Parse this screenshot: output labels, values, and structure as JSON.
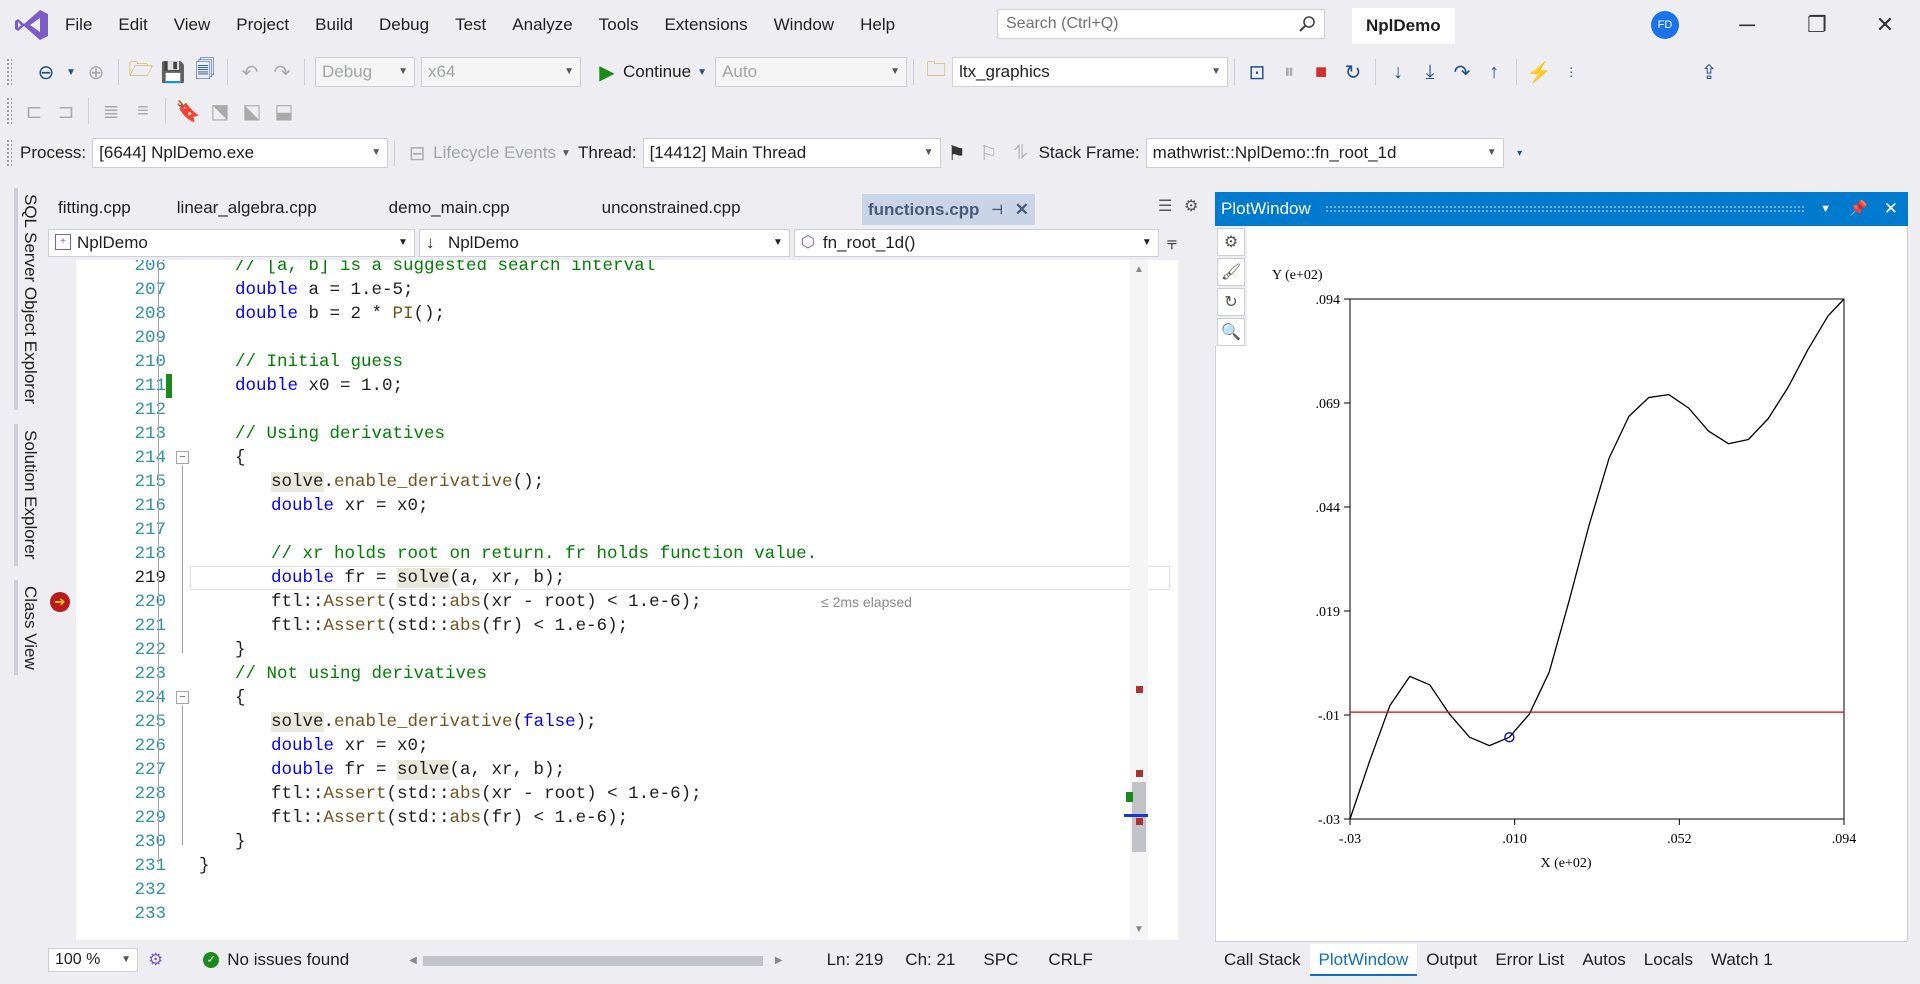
{
  "menu": [
    "File",
    "Edit",
    "View",
    "Project",
    "Build",
    "Debug",
    "Test",
    "Analyze",
    "Tools",
    "Extensions",
    "Window",
    "Help"
  ],
  "search": {
    "placeholder": "Search (Ctrl+Q)"
  },
  "solution_name": "NplDemo",
  "user_initials": "FD",
  "toolbar1": {
    "config": "Debug",
    "platform": "x64",
    "continue_label": "Continue",
    "auto_label": "Auto",
    "project": "ltx_graphics"
  },
  "toolbar3": {
    "process_label": "Process:",
    "process_value": "[6644] NplDemo.exe",
    "lifecycle_label": "Lifecycle Events",
    "thread_label": "Thread:",
    "thread_value": "[14412] Main Thread",
    "stack_label": "Stack Frame:",
    "stack_value": "mathwrist::NplDemo::fn_root_1d"
  },
  "side_tabs": [
    "SQL Server Object Explorer",
    "Solution Explorer",
    "Class View"
  ],
  "doc_tabs": [
    "fitting.cpp",
    "linear_algebra.cpp",
    "demo_main.cpp",
    "unconstrained.cpp"
  ],
  "active_tab": "functions.cpp",
  "nav": {
    "project": "NplDemo",
    "scope": "NplDemo",
    "member": "fn_root_1d()"
  },
  "code": [
    {
      "ln": "206",
      "segs": [
        [
          "cm",
          "// [a, b] is a suggested search interval"
        ]
      ],
      "indent": 1
    },
    {
      "ln": "207",
      "segs": [
        [
          "kw",
          "double"
        ],
        [
          "",
          " a = 1.e-5;"
        ]
      ],
      "indent": 1
    },
    {
      "ln": "208",
      "segs": [
        [
          "kw",
          "double"
        ],
        [
          "",
          " b = 2 * "
        ],
        [
          "fn",
          "PI"
        ],
        [
          "",
          "();"
        ]
      ],
      "indent": 1
    },
    {
      "ln": "209",
      "segs": [],
      "indent": 1
    },
    {
      "ln": "210",
      "segs": [
        [
          "cm",
          "// Initial guess"
        ]
      ],
      "indent": 1
    },
    {
      "ln": "211",
      "segs": [
        [
          "kw",
          "double"
        ],
        [
          "",
          " x0 = 1.0;"
        ]
      ],
      "indent": 1
    },
    {
      "ln": "212",
      "segs": [],
      "indent": 1
    },
    {
      "ln": "213",
      "segs": [
        [
          "cm",
          "// Using derivatives"
        ]
      ],
      "indent": 1
    },
    {
      "ln": "214",
      "segs": [
        [
          "",
          "{"
        ]
      ],
      "indent": 1
    },
    {
      "ln": "215",
      "segs": [
        [
          "hl",
          "solve"
        ],
        [
          "",
          "."
        ],
        [
          "fn",
          "enable_derivative"
        ],
        [
          "",
          "();"
        ]
      ],
      "indent": 2
    },
    {
      "ln": "216",
      "segs": [
        [
          "kw",
          "double"
        ],
        [
          "",
          " xr = x0;"
        ]
      ],
      "indent": 2
    },
    {
      "ln": "217",
      "segs": [],
      "indent": 2
    },
    {
      "ln": "218",
      "segs": [
        [
          "cm",
          "// xr holds root on return. fr holds function value."
        ]
      ],
      "indent": 2
    },
    {
      "ln": "219",
      "segs": [
        [
          "kw",
          "double"
        ],
        [
          "",
          " fr = "
        ],
        [
          "hl",
          "solve"
        ],
        [
          "",
          "(a, xr, b);"
        ]
      ],
      "indent": 2
    },
    {
      "ln": "220",
      "segs": [
        [
          "",
          "ftl::"
        ],
        [
          "fn",
          "Assert"
        ],
        [
          "",
          "(std::"
        ],
        [
          "fn",
          "abs"
        ],
        [
          "",
          "(xr - root) < 1.e-6);"
        ]
      ],
      "indent": 2
    },
    {
      "ln": "221",
      "segs": [
        [
          "",
          "ftl::"
        ],
        [
          "fn",
          "Assert"
        ],
        [
          "",
          "(std::"
        ],
        [
          "fn",
          "abs"
        ],
        [
          "",
          "(fr) < 1.e-6);"
        ]
      ],
      "indent": 2
    },
    {
      "ln": "222",
      "segs": [
        [
          "",
          "}"
        ]
      ],
      "indent": 1
    },
    {
      "ln": "223",
      "segs": [
        [
          "cm",
          "// Not using derivatives"
        ]
      ],
      "indent": 1
    },
    {
      "ln": "224",
      "segs": [
        [
          "",
          "{"
        ]
      ],
      "indent": 1
    },
    {
      "ln": "225",
      "segs": [
        [
          "hl",
          "solve"
        ],
        [
          "",
          "."
        ],
        [
          "fn",
          "enable_derivative"
        ],
        [
          "",
          "("
        ],
        [
          "kw",
          "false"
        ],
        [
          "",
          ");"
        ]
      ],
      "indent": 2
    },
    {
      "ln": "226",
      "segs": [
        [
          "kw",
          "double"
        ],
        [
          "",
          " xr = x0;"
        ]
      ],
      "indent": 2
    },
    {
      "ln": "227",
      "segs": [
        [
          "kw",
          "double"
        ],
        [
          "",
          " fr = "
        ],
        [
          "hl",
          "solve"
        ],
        [
          "",
          "(a, xr, b);"
        ]
      ],
      "indent": 2
    },
    {
      "ln": "228",
      "segs": [
        [
          "",
          "ftl::"
        ],
        [
          "fn",
          "Assert"
        ],
        [
          "",
          "(std::"
        ],
        [
          "fn",
          "abs"
        ],
        [
          "",
          "(xr - root) < 1.e-6);"
        ]
      ],
      "indent": 2
    },
    {
      "ln": "229",
      "segs": [
        [
          "",
          "ftl::"
        ],
        [
          "fn",
          "Assert"
        ],
        [
          "",
          "(std::"
        ],
        [
          "fn",
          "abs"
        ],
        [
          "",
          "(fr) < 1.e-6);"
        ]
      ],
      "indent": 2
    },
    {
      "ln": "230",
      "segs": [
        [
          "",
          "}"
        ]
      ],
      "indent": 1
    },
    {
      "ln": "231",
      "segs": [
        [
          "",
          "}"
        ]
      ],
      "indent": 0
    },
    {
      "ln": "232",
      "segs": [],
      "indent": 0
    },
    {
      "ln": "233",
      "segs": [],
      "indent": 0
    }
  ],
  "current_line": "219",
  "elapsed_hint": "≤ 2ms elapsed",
  "editor_status": {
    "zoom": "100 %",
    "issues": "No issues found",
    "ln": "Ln: 219",
    "ch": "Ch: 21",
    "spc": "SPC",
    "crlf": "CRLF"
  },
  "plot_window": {
    "title": "PlotWindow",
    "ylabel": "Y (e+02)",
    "xlabel": "X (e+02)"
  },
  "chart_data": {
    "type": "line",
    "title": "",
    "xlabel": "X (e+02)",
    "ylabel": "Y (e+02)",
    "xlim": [
      -0.03,
      0.094
    ],
    "ylim": [
      -0.03,
      0.094
    ],
    "x_ticks": [
      ".03",
      ".010",
      ".052",
      ".094"
    ],
    "x_tick_labels": [
      "-.03",
      ".010",
      ".052",
      ".094"
    ],
    "y_tick_labels": [
      "-.03",
      "-.01",
      ".019",
      ".044",
      ".069",
      ".094"
    ],
    "series": [
      {
        "color": "#000000",
        "x": [
          -0.03,
          -0.025,
          -0.02,
          -0.015,
          -0.01,
          -0.005,
          0.0,
          0.005,
          0.01,
          0.015,
          0.02,
          0.025,
          0.03,
          0.035,
          0.04,
          0.045,
          0.05,
          0.055,
          0.06,
          0.065,
          0.07,
          0.075,
          0.08,
          0.085,
          0.09,
          0.094
        ],
        "y": [
          -0.03,
          -0.016,
          -0.003,
          0.004,
          0.002,
          -0.005,
          -0.0105,
          -0.0125,
          -0.0105,
          -0.005,
          0.005,
          0.022,
          0.04,
          0.056,
          0.066,
          0.0705,
          0.0712,
          0.068,
          0.0625,
          0.0595,
          0.0605,
          0.0655,
          0.073,
          0.082,
          0.09,
          0.094
        ]
      },
      {
        "color": "#e00000",
        "x": [
          -0.03,
          0.094
        ],
        "y": [
          -0.0045,
          -0.0045
        ]
      }
    ],
    "marker": {
      "x": 0.01,
      "y": -0.0105
    }
  },
  "bottom_tabs": [
    "Call Stack",
    "PlotWindow",
    "Output",
    "Error List",
    "Autos",
    "Locals",
    "Watch 1"
  ],
  "active_bottom_tab": "PlotWindow"
}
